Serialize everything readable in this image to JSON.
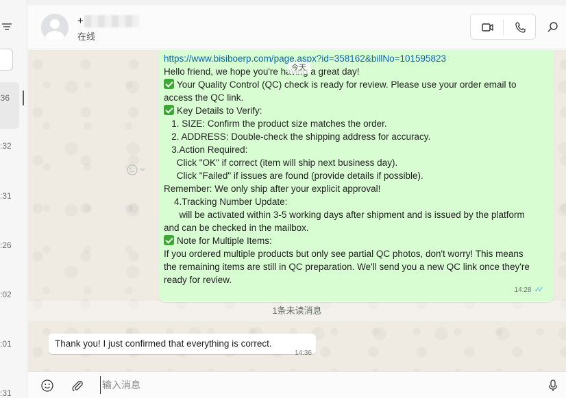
{
  "header": {
    "contact_name": "+",
    "contact_status": "在线"
  },
  "sidebar": {
    "times": [
      ":36",
      ":32",
      ":31",
      ":26",
      ":02",
      ":01",
      ":31"
    ]
  },
  "chat": {
    "date_pill": "今天",
    "outgoing": {
      "link": "https://www.bisiboerp.com/page.aspx?id=358162&billNo=101595823",
      "lines": [
        "Hello friend, we hope you're having a great day!",
        "Your Quality Control (QC) check is ready for review. Please use your order email to",
        "access the QC link.",
        "Key Details to Verify:",
        "   1. SIZE: Confirm the product size matches the order.",
        "   2. ADDRESS: Double-check the shipping address for accuracy.",
        "   3.Action Required:",
        "     Click \"OK\" if correct (item will ship next business day).",
        "     Click \"Failed\" if issues are found (provide details if possible).",
        "Remember: We only ship after your explicit approval!",
        "    4.Tracking Number Update:",
        "      will be activated within 3-5 working days after shipment and is issued by the platform",
        "and can be checked in the mailbox.",
        "Note for Multiple Items:",
        "If you ordered multiple products but only see partial QC photos, don't worry! This means",
        "the remaining items are still in QC preparation. We'll send you a new QC link once they're",
        "ready for review."
      ],
      "time": "14:28"
    },
    "unread_banner": "1条未读消息",
    "incoming": {
      "text": "Thank you! I just confirmed that everything is correct.",
      "time": "14:36"
    }
  },
  "composer": {
    "placeholder": "输入消息"
  },
  "colors": {
    "outgoing_bubble": "#d9fdd3",
    "chat_bg": "#efeae2",
    "link": "#0b63ad",
    "read_ticks": "#53a6e8"
  }
}
